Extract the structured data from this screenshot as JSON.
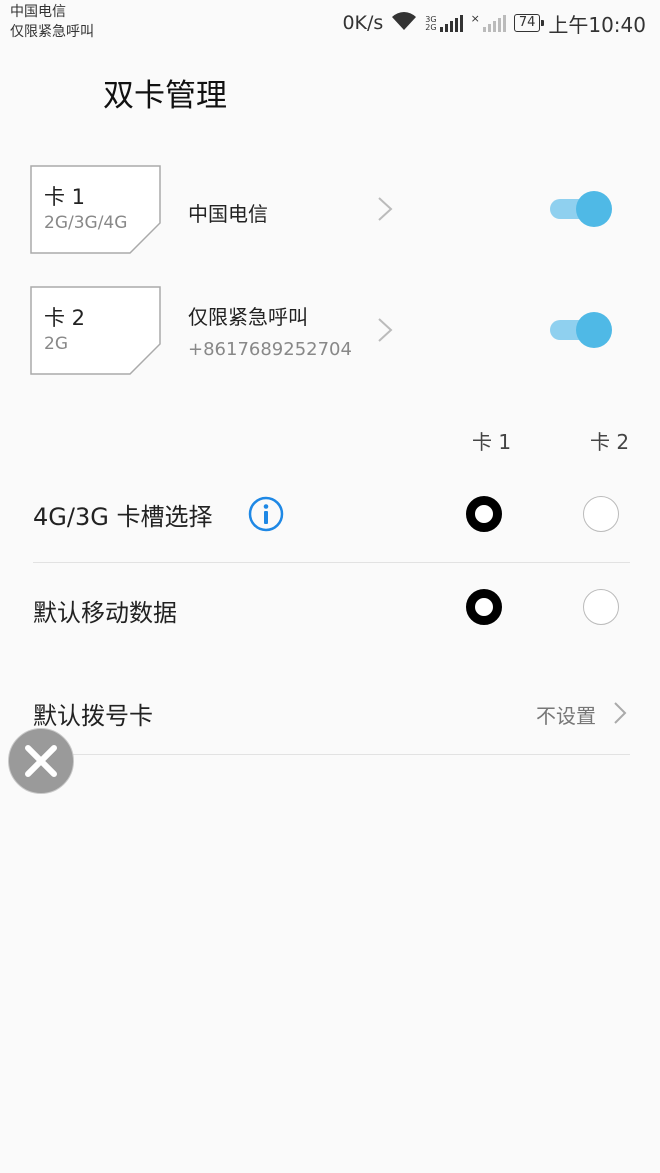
{
  "status_bar": {
    "carrier_line1": "中国电信",
    "carrier_line2": "仅限紧急呼叫",
    "net_speed": "0K/s",
    "sig1_label_top": "3G",
    "sig1_label_bottom": "2G",
    "battery": "74",
    "time": "上午10:40",
    "icons": [
      "wifi-icon",
      "signal-icon",
      "signal-icon",
      "battery-icon"
    ]
  },
  "page_title": "双卡管理",
  "sims": [
    {
      "card_label": "卡 1",
      "network": "2G/3G/4G",
      "title": "中国电信",
      "subtitle": "",
      "enabled": true
    },
    {
      "card_label": "卡 2",
      "network": "2G",
      "title": "仅限紧急呼叫",
      "subtitle": "+8617689252704",
      "enabled": true
    }
  ],
  "columns": {
    "card1": "卡 1",
    "card2": "卡 2"
  },
  "rows": {
    "slot_select": {
      "label": "4G/3G 卡槽选择",
      "selected": "card1"
    },
    "default_data": {
      "label": "默认移动数据",
      "selected": "card1"
    },
    "default_dial": {
      "label": "默认拨号卡",
      "value": "不设置"
    }
  },
  "colors": {
    "accent": "#4fb9e6",
    "accent_light": "#8fd0ef",
    "info_blue": "#1e88e5"
  }
}
